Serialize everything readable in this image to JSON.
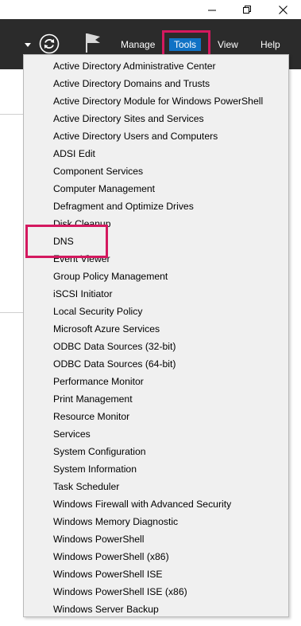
{
  "titlebar": {
    "minimize_icon": "minimize-icon",
    "restore_icon": "restore-icon",
    "close_icon": "close-icon"
  },
  "toolbar": {
    "icons": [
      "dropdown-arrow-icon",
      "refresh-icon",
      "flag-icon"
    ],
    "menu": [
      {
        "label": "Manage",
        "active": false
      },
      {
        "label": "Tools",
        "active": true
      },
      {
        "label": "View",
        "active": false
      },
      {
        "label": "Help",
        "active": false
      }
    ]
  },
  "tools_menu": {
    "items": [
      "Active Directory Administrative Center",
      "Active Directory Domains and Trusts",
      "Active Directory Module for Windows PowerShell",
      "Active Directory Sites and Services",
      "Active Directory Users and Computers",
      "ADSI Edit",
      "Component Services",
      "Computer Management",
      "Defragment and Optimize Drives",
      "Disk Cleanup",
      "DNS",
      "Event Viewer",
      "Group Policy Management",
      "iSCSI Initiator",
      "Local Security Policy",
      "Microsoft Azure Services",
      "ODBC Data Sources (32-bit)",
      "ODBC Data Sources (64-bit)",
      "Performance Monitor",
      "Print Management",
      "Resource Monitor",
      "Services",
      "System Configuration",
      "System Information",
      "Task Scheduler",
      "Windows Firewall with Advanced Security",
      "Windows Memory Diagnostic",
      "Windows PowerShell",
      "Windows PowerShell (x86)",
      "Windows PowerShell ISE",
      "Windows PowerShell ISE (x86)",
      "Windows Server Backup"
    ]
  },
  "colors": {
    "toolbar_bg": "#2b2b2b",
    "active_menu_bg": "#1072c5",
    "highlight_border": "#d4195f",
    "menu_bg": "#f0f0f0"
  }
}
